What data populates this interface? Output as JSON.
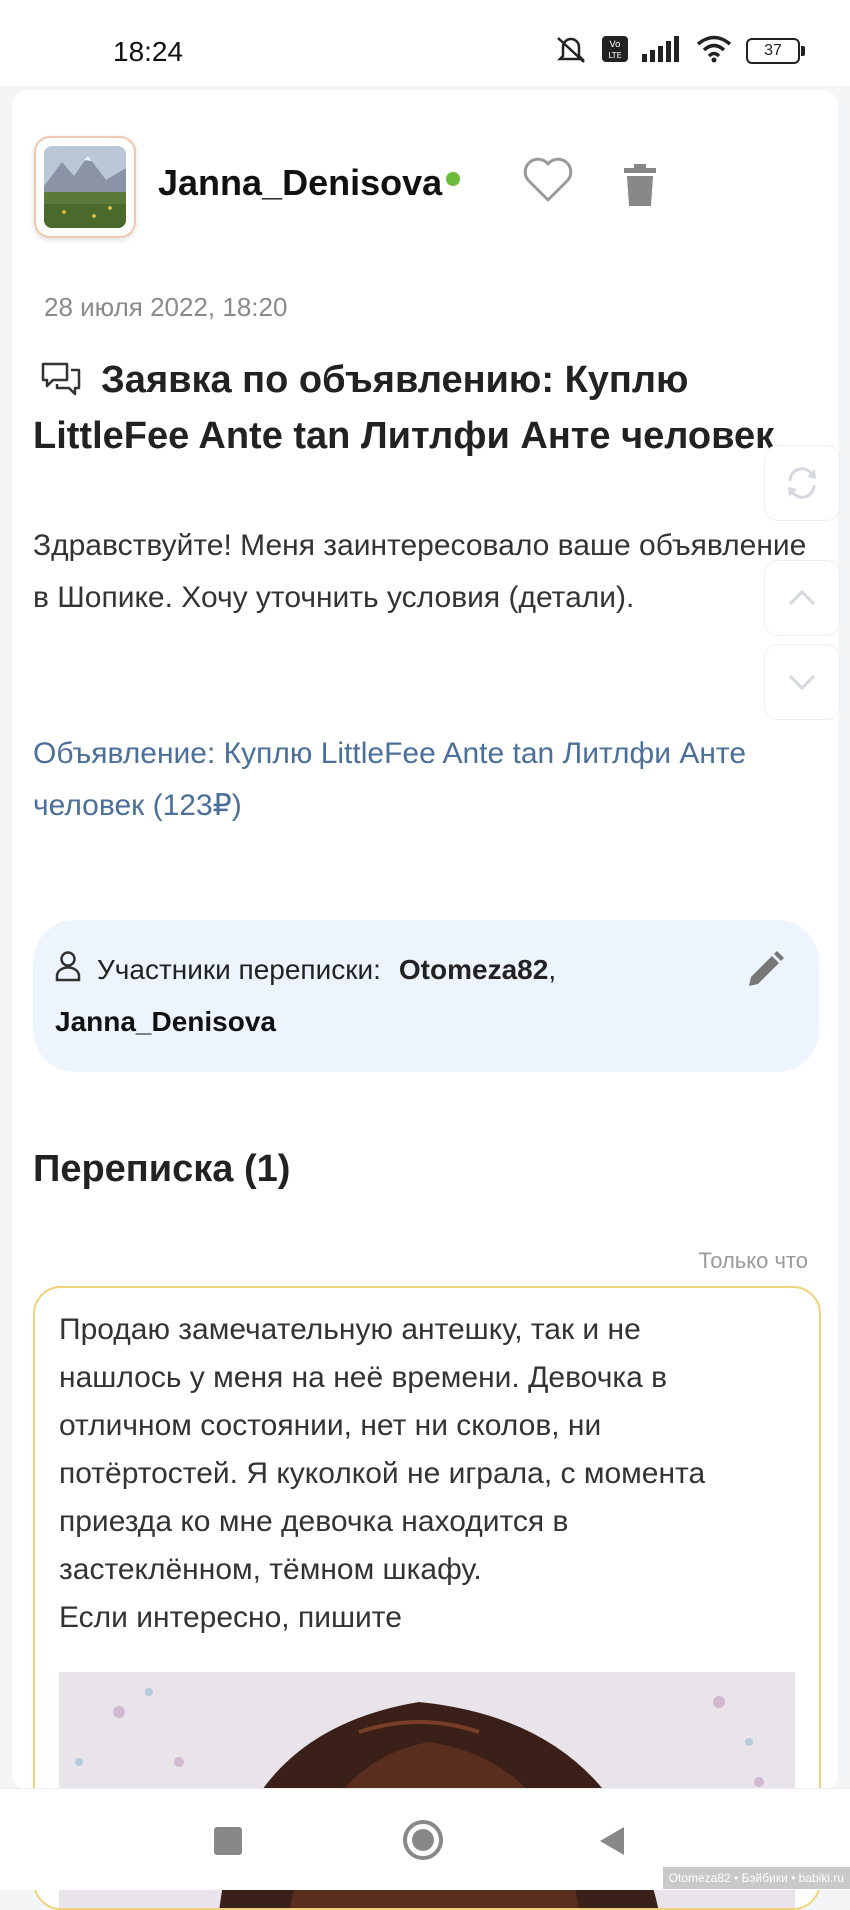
{
  "status_bar": {
    "time": "18:24",
    "battery": "37",
    "icons": [
      "mute-icon",
      "volte-icon",
      "signal-icon",
      "wifi-icon",
      "battery-icon"
    ]
  },
  "post": {
    "username": "Janna_Denisova",
    "online": true,
    "date": "28 июля 2022, 18:20",
    "title": "Заявка по объявлению: Куплю LittleFee Ante tan Литлфи Анте человек",
    "body": "Здравствуйте! Меня заинтересовало ваше объявление в Шопике. Хочу уточнить условия (детали).",
    "ad_link": "Объявление: Куплю LittleFee Ante tan Литлфи Анте человек (123₽)"
  },
  "participants": {
    "label": "Участники переписки:",
    "first": "Otomeza82",
    "separator": ",",
    "second": "Janna_Denisova"
  },
  "correspondence": {
    "title": "Переписка (1)",
    "message": {
      "time": "Только что",
      "text_lines": [
        "Продаю замечательную антешку, так и не",
        "нашлось у меня на неё времени. Девочка в",
        "отличном состоянии, нет ни сколов, ни",
        "потёртостей. Я куколкой не играла, с момента",
        "приезда ко мне девочка находится в",
        "застеклённом, тёмном шкафу.",
        "Если интересно, пишите"
      ]
    }
  },
  "watermark": "Otomeza82 • Бэйбики • babiki.ru",
  "colors": {
    "accent_link": "#4a6f99",
    "online": "#6dbb3c",
    "participants_bg": "#eef4fd",
    "message_border": "#f0d27a"
  }
}
